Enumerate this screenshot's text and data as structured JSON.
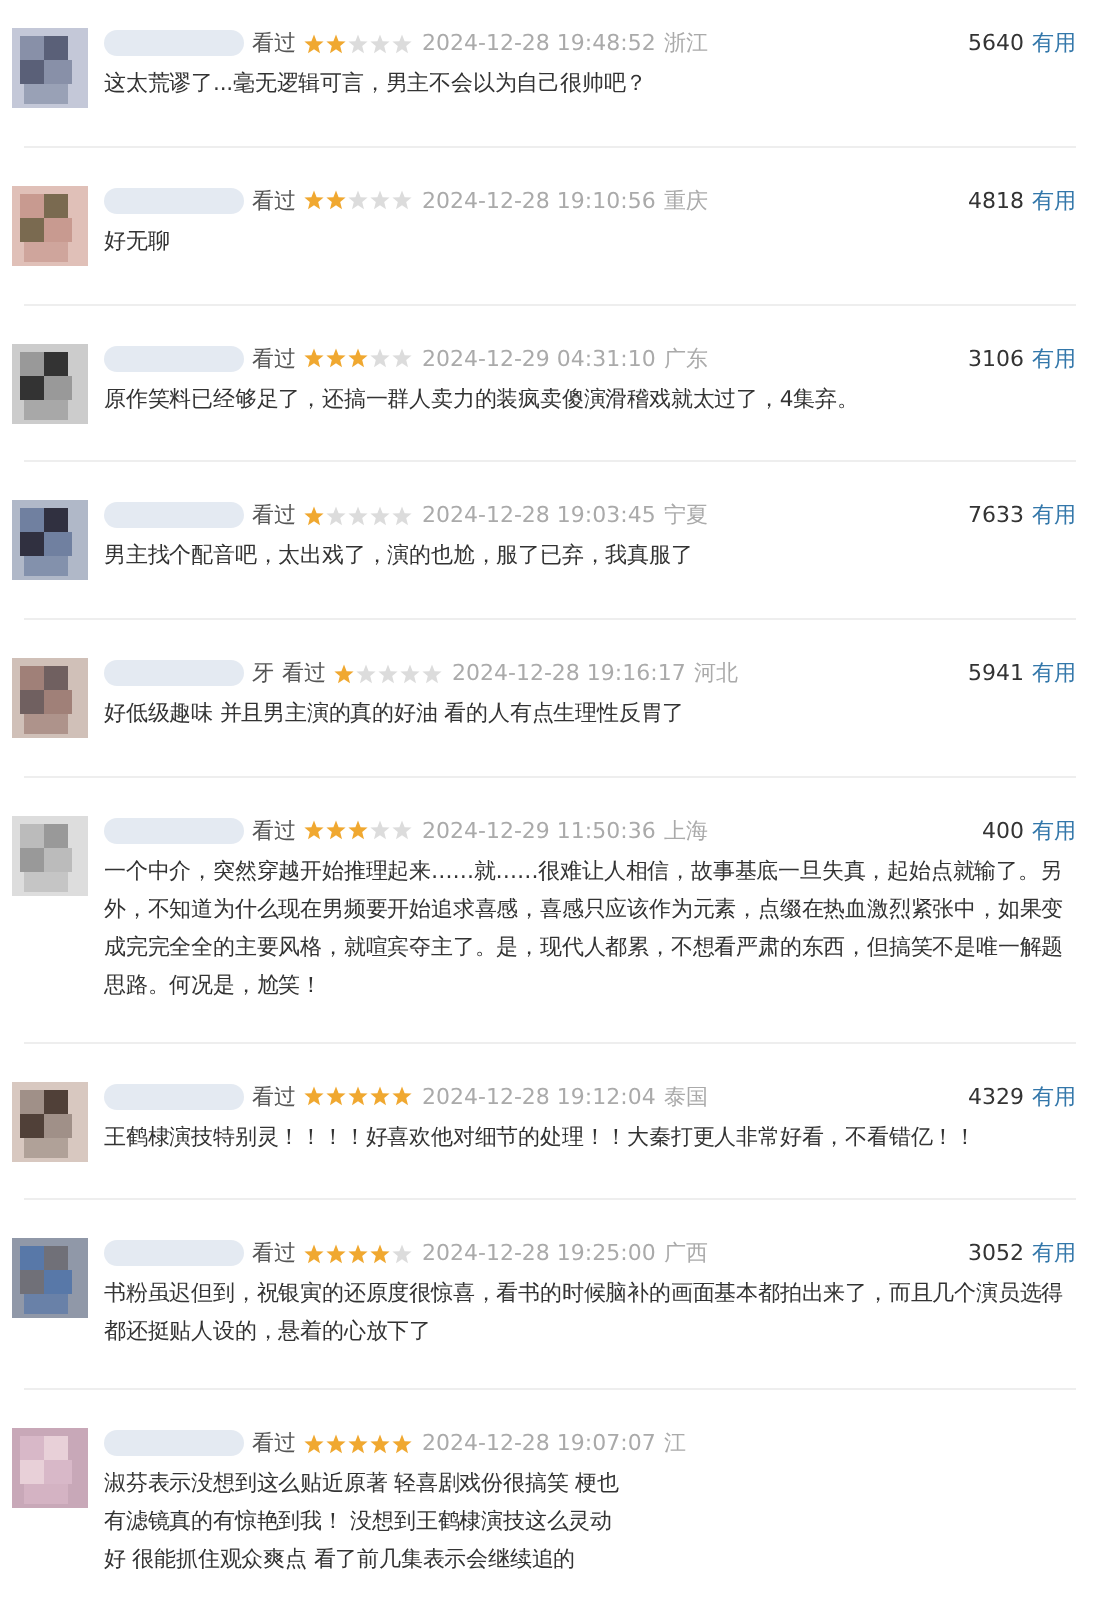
{
  "comments": [
    {
      "status": "看过",
      "stars": 2,
      "time": "2024-12-28 19:48:52",
      "location": "浙江",
      "votes": "5640",
      "vote_label": "有用",
      "lines": [
        "这太荒谬了...毫无逻辑可言，男主不会以为自己很帅吧？"
      ]
    },
    {
      "status": "看过",
      "stars": 2,
      "time": "2024-12-28 19:10:56",
      "location": "重庆",
      "votes": "4818",
      "vote_label": "有用",
      "lines": [
        "好无聊"
      ]
    },
    {
      "status": "看过",
      "stars": 3,
      "time": "2024-12-29 04:31:10",
      "location": "广东",
      "votes": "3106",
      "vote_label": "有用",
      "lines": [
        "原作笑料已经够足了，还搞一群人卖力的装疯卖傻演滑稽戏就太过了，4集弃。"
      ]
    },
    {
      "status": "看过",
      "stars": 1,
      "time": "2024-12-28 19:03:45",
      "location": "宁夏",
      "votes": "7633",
      "vote_label": "有用",
      "lines": [
        "男主找个配音吧，太出戏了，演的也尬，服了已弃，我真服了"
      ]
    },
    {
      "name": "牙",
      "status": "看过",
      "stars": 1,
      "time": "2024-12-28 19:16:17",
      "location": "河北",
      "votes": "5941",
      "vote_label": "有用",
      "lines": [
        "好低级趣味 并且男主演的真的好油 看的人有点生理性反胃了"
      ]
    },
    {
      "status": "看过",
      "stars": 3,
      "time": "2024-12-29 11:50:36",
      "location": "上海",
      "votes": "400",
      "vote_label": "有用",
      "lines": [
        "一个中介，突然穿越开始推理起来……就……很难让人相信，故事基底一旦失真，起始点就输了。另外，不知道为什么现在男频要开始追求喜感，喜感只应该作为元素，点缀在热血激烈紧张中，如果变成完完全全的主要风格，就喧宾夺主了。是，现代人都累，不想看严肃的东西，但搞笑不是唯一解题思路。何况是，尬笑！"
      ]
    },
    {
      "status": "看过",
      "stars": 5,
      "time": "2024-12-28 19:12:04",
      "location": "泰国",
      "votes": "4329",
      "vote_label": "有用",
      "lines": [
        "王鹤棣演技特别灵！！！！好喜欢他对细节的处理！！大秦打更人非常好看，不看错亿！！"
      ]
    },
    {
      "status": "看过",
      "stars": 4,
      "time": "2024-12-28 19:25:00",
      "location": "广西",
      "votes": "3052",
      "vote_label": "有用",
      "lines": [
        "书粉虽迟但到，祝银寅的还原度很惊喜，看书的时候脑补的画面基本都拍出来了，而且几个演员选得都还挺贴人设的，悬着的心放下了"
      ]
    },
    {
      "status": "看过",
      "stars": 5,
      "time": "2024-12-28 19:07:07",
      "location": "江",
      "lines": [
        "淑芬表示没想到这么贴近原著 轻喜剧戏份很搞笑 梗也",
        "有滤镜真的有惊艳到我！ 没想到王鹤棣演技这么灵动",
        "好 很能抓住观众爽点 看了前几集表示会继续追的"
      ]
    }
  ]
}
